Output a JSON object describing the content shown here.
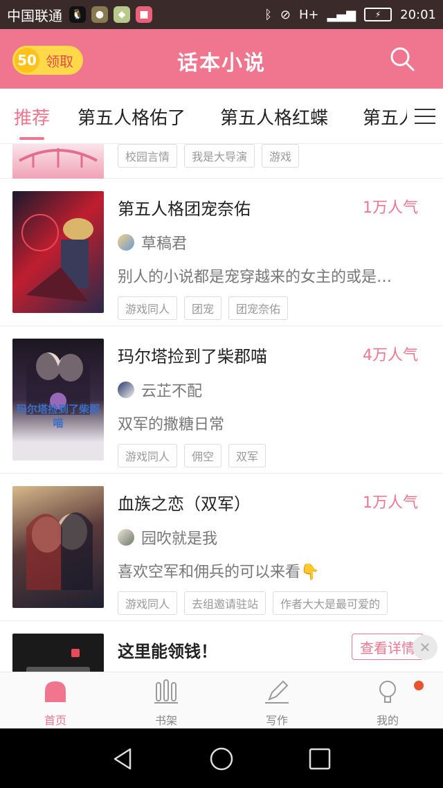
{
  "status_bar": {
    "carrier": "中国联通",
    "time": "20:01",
    "signal": "H+"
  },
  "header": {
    "reward_amount": "50",
    "reward_label": "领取",
    "title": "话本小说",
    "accent_color": "#f0758e"
  },
  "tabs": [
    {
      "label": "推荐"
    },
    {
      "label": "第五人格佑了"
    },
    {
      "label": "第五人格红蝶"
    },
    {
      "label": "第五人"
    }
  ],
  "partial_row": {
    "tags": [
      "校园言情",
      "我是大导演",
      "游戏"
    ]
  },
  "stories": [
    {
      "title": "第五人格团宠奈佑",
      "popularity": "1万人气",
      "author": "草稿君",
      "description": "别人的小说都是宠穿越来的女主的或是…",
      "tags": [
        "游戏同人",
        "团宠",
        "团宠奈佑"
      ]
    },
    {
      "title": "玛尔塔捡到了柴郡喵",
      "popularity": "4万人气",
      "author": "云芷不配",
      "description": "双军的撒糖日常",
      "tags": [
        "游戏同人",
        "佣空",
        "双军"
      ],
      "cover_text": "玛尔塔捡到了柴郡喵"
    },
    {
      "title": "血族之恋（双军）",
      "popularity": "1万人气",
      "author": "园吹就是我",
      "description": "喜欢空军和佣兵的可以来看👇",
      "tags": [
        "游戏同人",
        "去组邀请驻站",
        "作者大大是最可爱的"
      ]
    }
  ],
  "ad": {
    "title": "这里能领钱！",
    "button_label": "查看详情"
  },
  "bottom_nav": [
    {
      "label": "首页",
      "icon": "home-icon",
      "active": true
    },
    {
      "label": "书架",
      "icon": "bookshelf-icon",
      "active": false
    },
    {
      "label": "写作",
      "icon": "pen-icon",
      "active": false
    },
    {
      "label": "我的",
      "icon": "profile-icon",
      "active": false
    }
  ]
}
